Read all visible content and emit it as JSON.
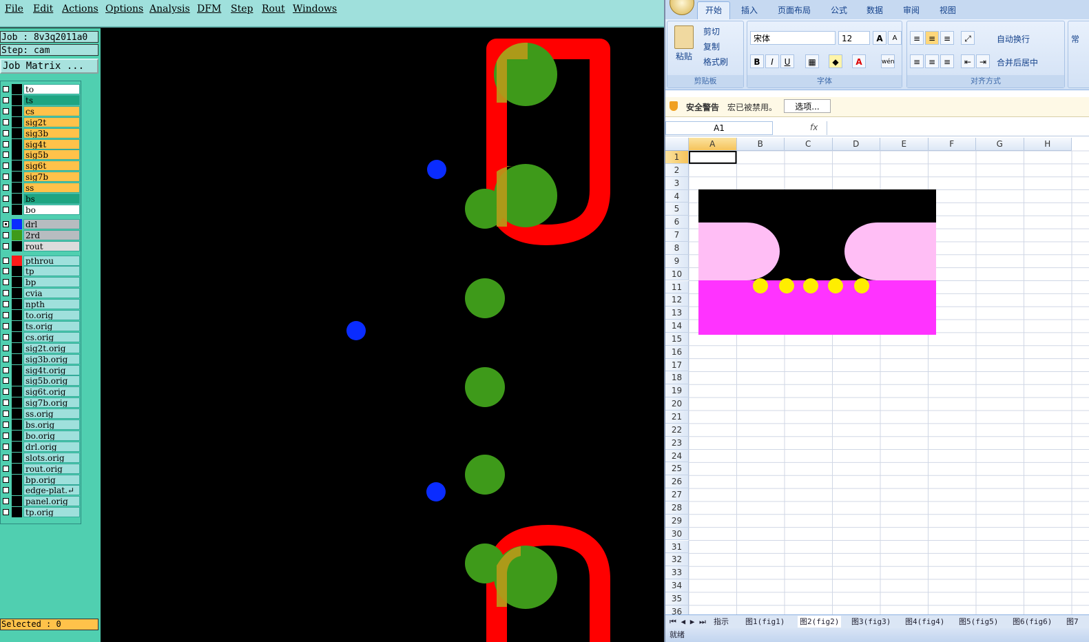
{
  "cam": {
    "menu": [
      "File",
      "Edit",
      "Actions",
      "Options",
      "Analysis",
      "DFM",
      "Step",
      "Rout",
      "Windows"
    ],
    "job_label": "Job : 8v3q2011a0",
    "step_label": "Step: cam",
    "job_matrix_button": "Job Matrix ...",
    "selected_label": "Selected : 0",
    "layers": [
      {
        "name": "to",
        "bg": "#ffffff",
        "swatch": "#000000",
        "checked": false
      },
      {
        "name": "ts",
        "bg": "#1ea582",
        "swatch": "#000000",
        "checked": false
      },
      {
        "name": "cs",
        "bg": "#ffc24a",
        "swatch": "#000000",
        "checked": false
      },
      {
        "name": "sig2t",
        "bg": "#ffc24a",
        "swatch": "#000000",
        "checked": false
      },
      {
        "name": "sig3b",
        "bg": "#ffc24a",
        "swatch": "#000000",
        "checked": false
      },
      {
        "name": "sig4t",
        "bg": "#ffc24a",
        "swatch": "#000000",
        "checked": false
      },
      {
        "name": "sig5b",
        "bg": "#ffc24a",
        "swatch": "#000000",
        "checked": false
      },
      {
        "name": "sig6t",
        "bg": "#ffc24a",
        "swatch": "#000000",
        "checked": false
      },
      {
        "name": "sig7b",
        "bg": "#ffc24a",
        "swatch": "#000000",
        "checked": false
      },
      {
        "name": "ss",
        "bg": "#ffc24a",
        "swatch": "#000000",
        "checked": false
      },
      {
        "name": "bs",
        "bg": "#1ea582",
        "swatch": "#000000",
        "checked": false
      },
      {
        "name": "bo",
        "bg": "#ffffff",
        "swatch": "#000000",
        "checked": false
      },
      {
        "name": "drl",
        "bg": "#b7bcc0",
        "swatch": "#0a2cff",
        "checked": true
      },
      {
        "name": "2rd",
        "bg": "#b7bcc0",
        "swatch": "#3e9a1a",
        "checked": false
      },
      {
        "name": "rout",
        "bg": "#dcdcdc",
        "swatch": "#000000",
        "checked": false
      },
      {
        "name": "pthrou",
        "bg": "#9fe0dc",
        "swatch": "#ff1a1a",
        "checked": false
      },
      {
        "name": "tp",
        "bg": "#9fe0dc",
        "swatch": "#000000",
        "checked": false
      },
      {
        "name": "bp",
        "bg": "#9fe0dc",
        "swatch": "#000000",
        "checked": false
      },
      {
        "name": "cvia",
        "bg": "#9fe0dc",
        "swatch": "#000000",
        "checked": false
      },
      {
        "name": "npth",
        "bg": "#9fe0dc",
        "swatch": "#000000",
        "checked": false
      },
      {
        "name": "to.orig",
        "bg": "#9fe0dc",
        "swatch": "#000000",
        "checked": false
      },
      {
        "name": "ts.orig",
        "bg": "#9fe0dc",
        "swatch": "#000000",
        "checked": false
      },
      {
        "name": "cs.orig",
        "bg": "#9fe0dc",
        "swatch": "#000000",
        "checked": false
      },
      {
        "name": "sig2t.orig",
        "bg": "#9fe0dc",
        "swatch": "#000000",
        "checked": false
      },
      {
        "name": "sig3b.orig",
        "bg": "#9fe0dc",
        "swatch": "#000000",
        "checked": false
      },
      {
        "name": "sig4t.orig",
        "bg": "#9fe0dc",
        "swatch": "#000000",
        "checked": false
      },
      {
        "name": "sig5b.orig",
        "bg": "#9fe0dc",
        "swatch": "#000000",
        "checked": false
      },
      {
        "name": "sig6t.orig",
        "bg": "#9fe0dc",
        "swatch": "#000000",
        "checked": false
      },
      {
        "name": "sig7b.orig",
        "bg": "#9fe0dc",
        "swatch": "#000000",
        "checked": false
      },
      {
        "name": "ss.orig",
        "bg": "#9fe0dc",
        "swatch": "#000000",
        "checked": false
      },
      {
        "name": "bs.orig",
        "bg": "#9fe0dc",
        "swatch": "#000000",
        "checked": false
      },
      {
        "name": "bo.orig",
        "bg": "#9fe0dc",
        "swatch": "#000000",
        "checked": false
      },
      {
        "name": "drl.orig",
        "bg": "#9fe0dc",
        "swatch": "#000000",
        "checked": false
      },
      {
        "name": "slots.orig",
        "bg": "#9fe0dc",
        "swatch": "#000000",
        "checked": false
      },
      {
        "name": "rout.orig",
        "bg": "#9fe0dc",
        "swatch": "#000000",
        "checked": false
      },
      {
        "name": "bp.orig",
        "bg": "#9fe0dc",
        "swatch": "#000000",
        "checked": false
      },
      {
        "name": "edge-plat.↵",
        "bg": "#9fe0dc",
        "swatch": "#000000",
        "checked": false
      },
      {
        "name": "panel.orig",
        "bg": "#9fe0dc",
        "swatch": "#000000",
        "checked": false
      },
      {
        "name": "tp.orig",
        "bg": "#9fe0dc",
        "swatch": "#000000",
        "checked": false
      }
    ],
    "colors": {
      "drill": "#0a2cff",
      "pad": "#3e9a1a",
      "overlap": "#b89a1a",
      "rout": "#ff0000",
      "canvas_bg": "#000000"
    }
  },
  "excel": {
    "tabs": [
      "开始",
      "插入",
      "页面布局",
      "公式",
      "数据",
      "审阅",
      "视图"
    ],
    "active_tab": "开始",
    "clipboard": {
      "paste": "粘贴",
      "cut": "剪切",
      "copy": "复制",
      "format_painter": "格式刷",
      "group": "剪贴板"
    },
    "font": {
      "name": "宋体",
      "size": "12",
      "group": "字体",
      "bold": "B",
      "italic": "I",
      "underline": "U",
      "grow": "A",
      "shrink": "A",
      "fill_icon": "fill-color-icon",
      "font_color_icon": "font-color-icon",
      "phonetic": "wén"
    },
    "alignment": {
      "wrap": "自动换行",
      "merge": "合并后居中",
      "group": "对齐方式",
      "next": "常"
    },
    "security": {
      "title": "安全警告",
      "message": "宏已被禁用。",
      "button": "选项..."
    },
    "name_box": "A1",
    "fx": "fx",
    "columns": [
      "A",
      "B",
      "C",
      "D",
      "E",
      "F",
      "G",
      "H"
    ],
    "rows": [
      "1",
      "2",
      "3",
      "4",
      "5",
      "6",
      "7",
      "8",
      "9",
      "10",
      "11",
      "12",
      "13",
      "14",
      "15",
      "16",
      "17",
      "18",
      "19",
      "20",
      "21",
      "22",
      "23",
      "24",
      "25",
      "26",
      "27",
      "28",
      "29",
      "30",
      "31",
      "32",
      "33",
      "34",
      "35",
      "36"
    ],
    "sheets": [
      "指示",
      "图1(fig1)",
      "图2(fig2)",
      "图3(fig3)",
      "图4(fig4)",
      "图5(fig5)",
      "图6(fig6)",
      "图7"
    ],
    "active_sheet": "图2(fig2)",
    "status": "就绪",
    "diagram_colors": {
      "black": "#000000",
      "pink": "#ffbef5",
      "magenta": "#ff33ff",
      "yellow": "#ffee00"
    }
  }
}
